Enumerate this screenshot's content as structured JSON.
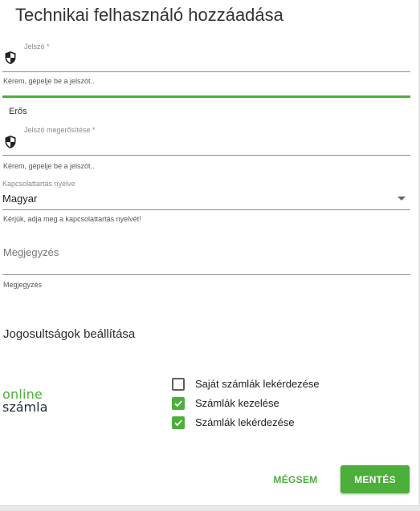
{
  "dialog": {
    "title": "Technikai felhasználó hozzáadása"
  },
  "password": {
    "label": "Jelszó *",
    "value": "",
    "hint": "Kérem, gépelje be a jelszót..",
    "icon": "shield-icon",
    "strength_label": "Erős",
    "strength_color": "#4caf3a",
    "strength_level": 1.0
  },
  "password_confirm": {
    "label": "Jelszó megerősítése *",
    "value": "",
    "hint": "Kérem, gépelje be a jelszót..",
    "icon": "shield-icon"
  },
  "language": {
    "label": "Kapcsolattartás nyelve",
    "selected": "Magyar",
    "hint": "Kérjük, adja meg a kapcsolattartás nyelvét!"
  },
  "note": {
    "placeholder": "Megjegyzés",
    "hint": "Megjegyzés"
  },
  "permissions": {
    "title": "Jogosultságok beállítása",
    "logo_line1": "online",
    "logo_line2": "számla",
    "items": [
      {
        "label": "Saját számlák lekérdezése",
        "checked": false
      },
      {
        "label": "Számlák kezelése",
        "checked": true
      },
      {
        "label": "Számlák lekérdezése",
        "checked": true
      }
    ]
  },
  "actions": {
    "cancel_label": "MÉGSEM",
    "save_label": "MENTÉS"
  },
  "colors": {
    "accent": "#4caf3a",
    "text": "#212121"
  }
}
